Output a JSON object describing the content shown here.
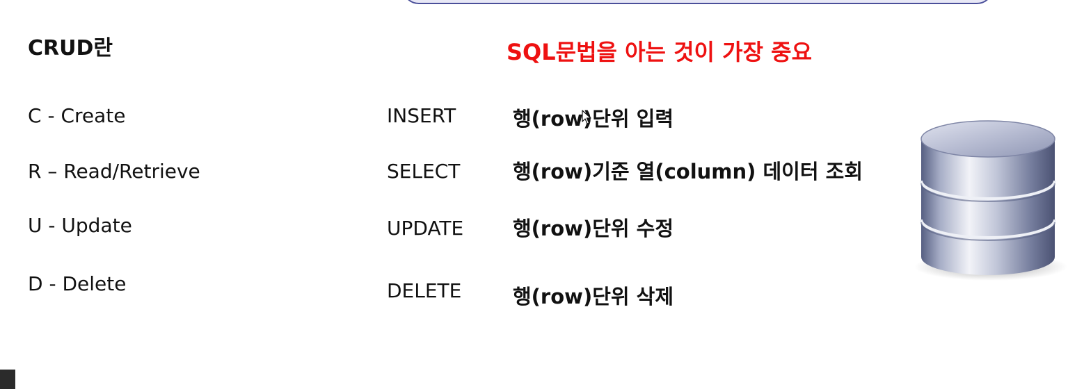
{
  "slide": {
    "title": "CRUD란",
    "highlight": "SQL문법을 아는 것이 가장 중요",
    "accent_color": "#ee1111",
    "rows": [
      {
        "crud": "C - Create",
        "sql": "INSERT",
        "desc": "행(row)단위 입력"
      },
      {
        "crud": "R – Read/Retrieve",
        "sql": "SELECT",
        "desc": "행(row)기준 열(column) 데이터 조회"
      },
      {
        "crud": "U - Update",
        "sql": "UPDATE",
        "desc": "행(row)단위 수정"
      },
      {
        "crud": "D - Delete",
        "sql": "DELETE",
        "desc": "행(row)단위 삭제"
      }
    ]
  },
  "icons": {
    "database": "database-icon",
    "cursor": "mouse-cursor-icon"
  }
}
